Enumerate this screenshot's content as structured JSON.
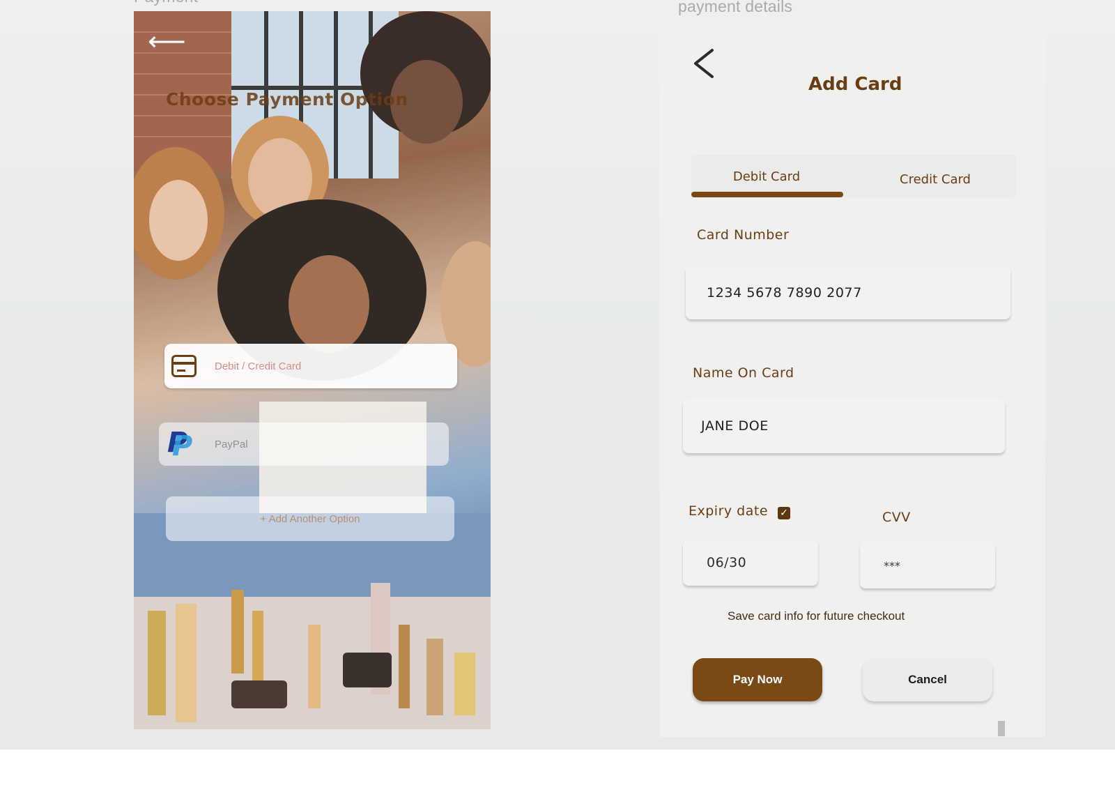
{
  "left_screen": {
    "frame_title": "Payment",
    "title": "Choose Payment Option",
    "back_icon": "arrow-left-icon",
    "options": [
      {
        "label": "Debit / Credit Card",
        "icon": "credit-card-icon"
      },
      {
        "label": "PayPal",
        "icon": "paypal-icon"
      },
      {
        "label": "+ Add Another Option"
      }
    ]
  },
  "right_screen": {
    "frame_title": "payment details",
    "back_icon": "chevron-left-icon",
    "title": "Add Card",
    "tabs": [
      {
        "label": "Debit Card",
        "selected": true
      },
      {
        "label": "Credit Card",
        "selected": false
      }
    ],
    "card_number": {
      "label": "Card Number",
      "value": "1234  5678  7890 2077"
    },
    "name_on_card": {
      "label": "Name On Card",
      "value": "JANE DOE"
    },
    "expiry": {
      "label": "Expiry date",
      "value": "06/30",
      "checked": true,
      "check_glyph": "✓"
    },
    "cvv": {
      "label": "CVV",
      "value": "***"
    },
    "save_info": "Save card info for future checkout",
    "pay_now_label": "Pay Now",
    "cancel_label": "Cancel"
  },
  "colors": {
    "accent": "#7a4a14",
    "brand_text": "#6b3d13",
    "panel_bg": "#f0f0ee"
  }
}
